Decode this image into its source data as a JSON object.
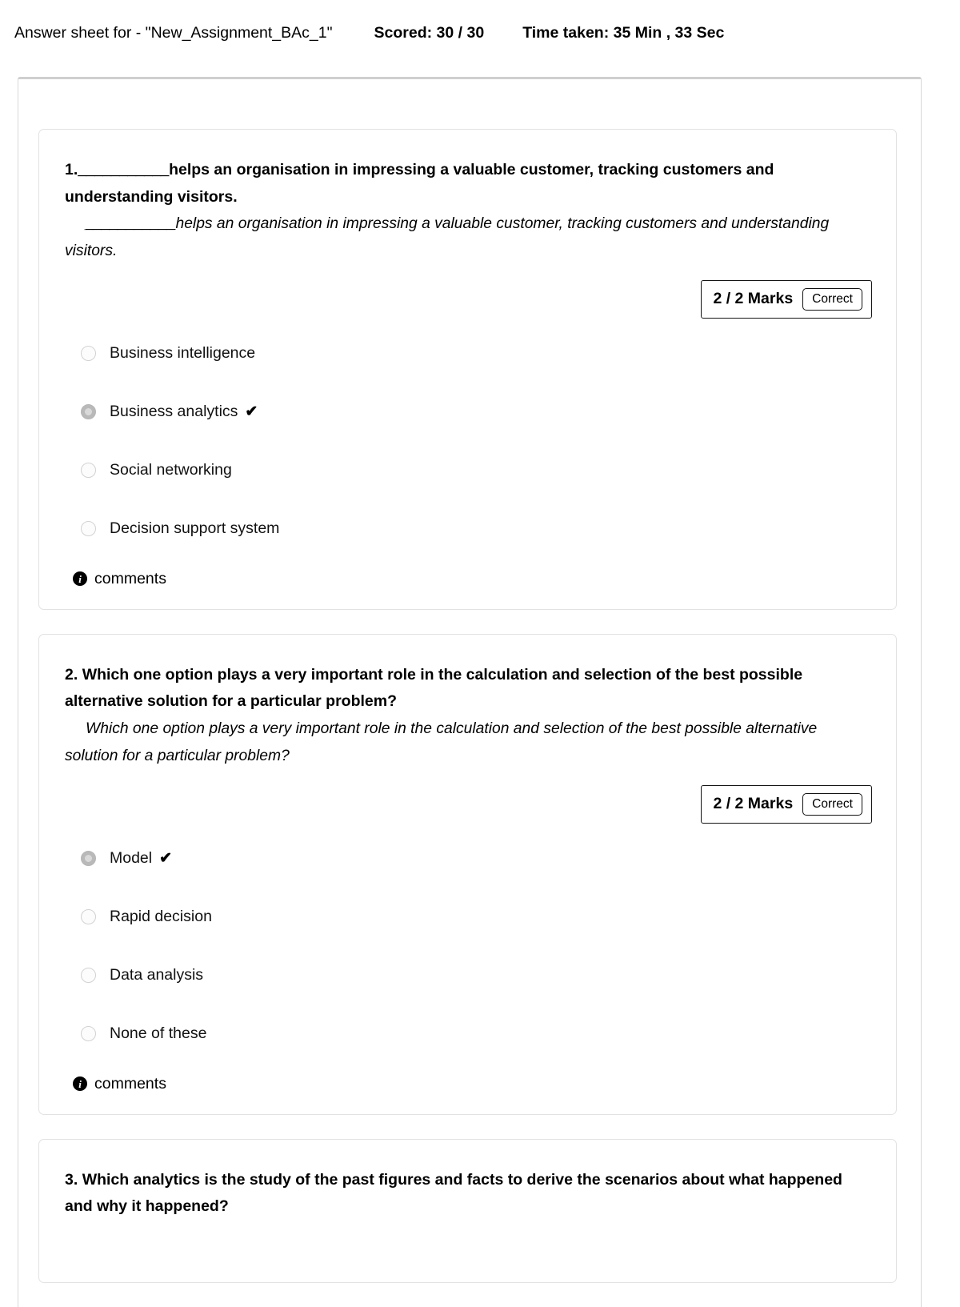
{
  "header": {
    "title": "Answer sheet for - \"New_Assignment_BAc_1\"",
    "scored": "Scored: 30 / 30",
    "time_taken": "Time taken: 35 Min , 33 Sec"
  },
  "comments_label": "comments",
  "check_glyph": "✔",
  "info_glyph": "i",
  "questions": [
    {
      "number": "1.",
      "title_blank": "___________",
      "title_rest": "helps an organisation in impressing a valuable customer, tracking customers and understanding visitors.",
      "subtitle_blank": "___________",
      "subtitle_rest": "helps an organisation in impressing a valuable customer, tracking customers and understanding visitors.",
      "marks": "2 / 2 Marks",
      "status": "Correct",
      "options": [
        {
          "label": "Business intelligence",
          "selected": false,
          "correct": false
        },
        {
          "label": "Business analytics",
          "selected": true,
          "correct": true
        },
        {
          "label": "Social networking",
          "selected": false,
          "correct": false
        },
        {
          "label": "Decision support system",
          "selected": false,
          "correct": false
        }
      ]
    },
    {
      "number": "2.",
      "title_rest": "Which one option plays a very important role in the calculation and selection of the best possible alternative solution for a particular problem?",
      "subtitle_rest": "Which one option plays a very important role in the calculation and selection of the best possible alternative solution for a particular problem?",
      "marks": "2 / 2 Marks",
      "status": "Correct",
      "options": [
        {
          "label": "Model",
          "selected": true,
          "correct": true
        },
        {
          "label": "Rapid decision",
          "selected": false,
          "correct": false
        },
        {
          "label": "Data analysis",
          "selected": false,
          "correct": false
        },
        {
          "label": "None of these",
          "selected": false,
          "correct": false
        }
      ]
    },
    {
      "number": "3.",
      "title_rest": "Which analytics is the study of the past figures and facts to derive the scenarios about what happened and why it happened?"
    }
  ]
}
